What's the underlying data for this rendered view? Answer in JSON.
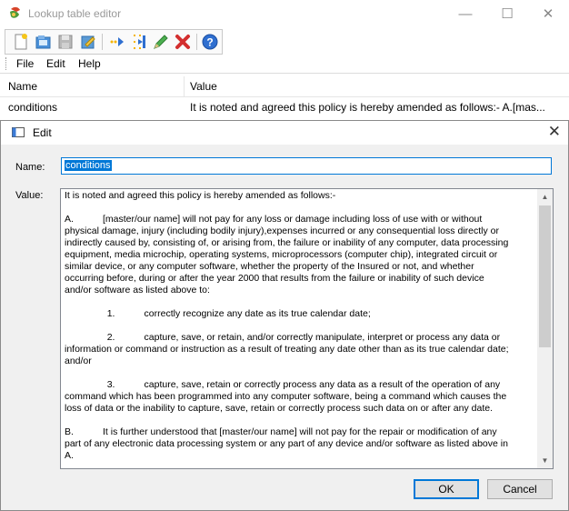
{
  "window": {
    "title": "Lookup table editor",
    "controls": {
      "minimize": "—",
      "maximize": "☐",
      "close": "✕"
    }
  },
  "toolbar": {
    "buttons": [
      "new-icon",
      "open-icon",
      "save-icon",
      "edit-table-icon",
      "run-icon",
      "insert-row-icon",
      "edit-pencil-icon",
      "delete-icon",
      "help-icon"
    ]
  },
  "menu": {
    "file": "File",
    "edit": "Edit",
    "help": "Help"
  },
  "grid": {
    "headers": {
      "name": "Name",
      "value": "Value"
    },
    "rows": [
      {
        "name": "conditions",
        "value": "It is noted and agreed this policy is hereby amended as follows:- A.[mas..."
      }
    ]
  },
  "dialog": {
    "title": "Edit",
    "close": "✕",
    "name_label": "Name:",
    "name_value": "conditions",
    "value_label": "Value:",
    "value_text": "It is noted and agreed this policy is hereby amended as follows:-\n\nA.           [master/our name] will not pay for any loss or damage including loss of use with or without\nphysical damage, injury (including bodily injury),expenses incurred or any consequential loss directly or\nindirectly caused by, consisting of, or arising from, the failure or inability of any computer, data processing\nequipment, media microchip, operating systems, microprocessors (computer chip), integrated circuit or\nsimilar device, or any computer software, whether the property of the Insured or not, and whether\noccurring before, during or after the year 2000 that results from the failure or inability of such device\nand/or software as listed above to:\n\n                1.           correctly recognize any date as its true calendar date;\n\n                2.           capture, save, or retain, and/or correctly manipulate, interpret or process any data or\ninformation or command or instruction as a result of treating any date other than as its true calendar date;\nand/or\n\n                3.           capture, save, retain or correctly process any data as a result of the operation of any\ncommand which has been programmed into any computer software, being a command which causes the\nloss of data or the inability to capture, save, retain or correctly process such data on or after any date.\n\nB.           It is further understood that [master/our name] will not pay for the repair or modification of any\npart of any electronic data processing system or any part of any device and/or software as listed above in\nA.",
    "ok_label": "OK",
    "cancel_label": "Cancel"
  },
  "colors": {
    "accent": "#0078d7",
    "dialog_bg": "#f0f0f0"
  }
}
